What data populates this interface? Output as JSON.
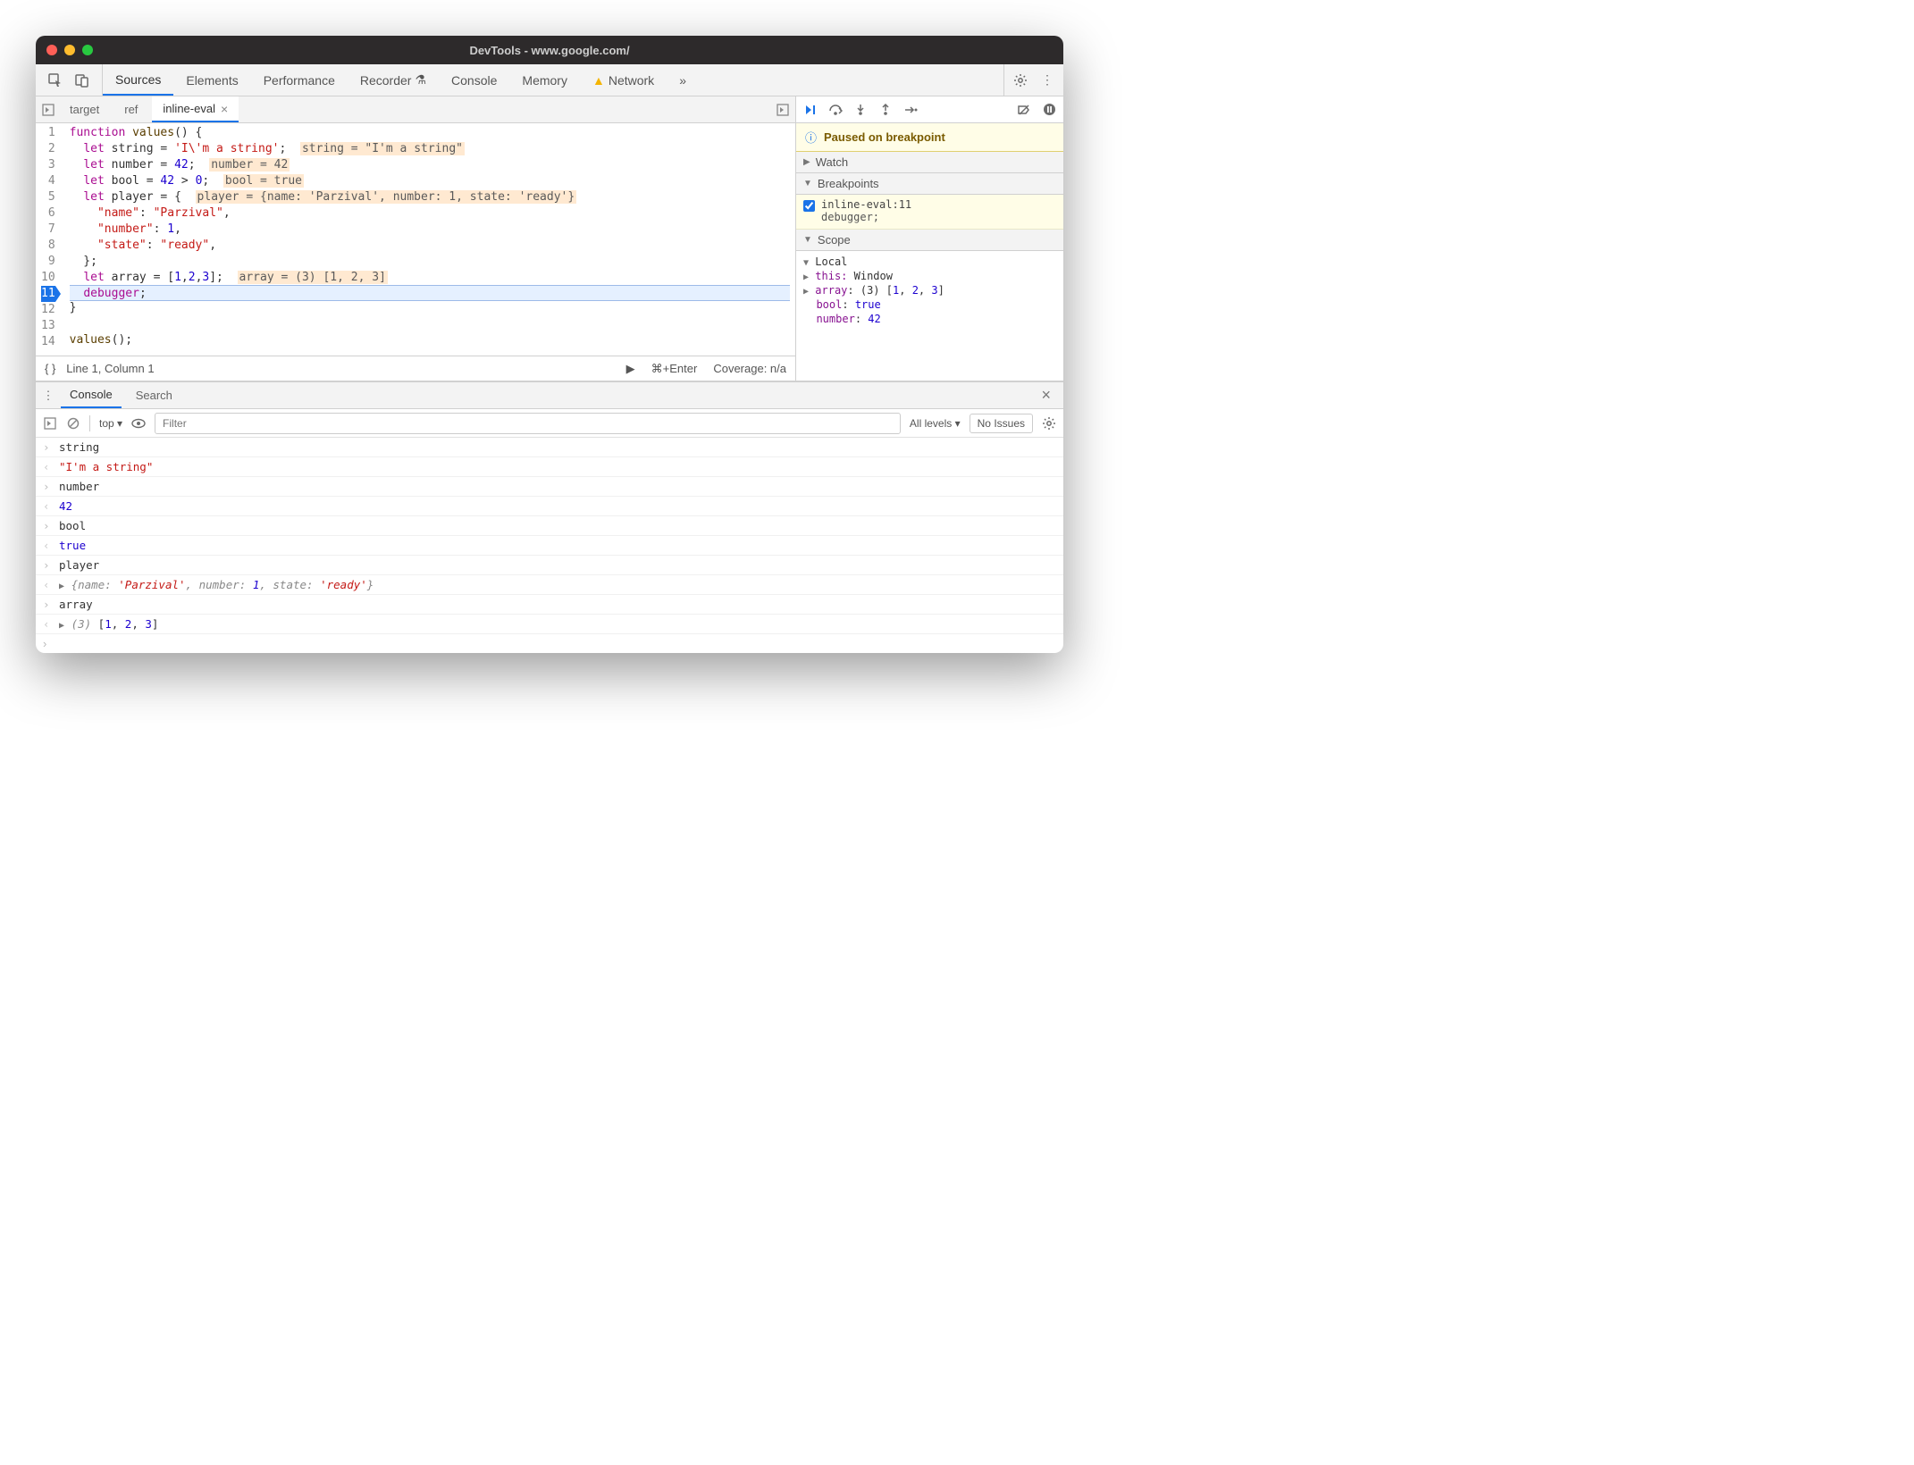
{
  "window": {
    "title": "DevTools - www.google.com/"
  },
  "toolbar": {
    "tabs": [
      "Sources",
      "Elements",
      "Performance",
      "Recorder",
      "Console",
      "Memory",
      "Network"
    ],
    "active": "Sources",
    "has_warning": true
  },
  "file_tabs": {
    "items": [
      {
        "label": "target",
        "active": false
      },
      {
        "label": "ref",
        "active": false
      },
      {
        "label": "inline-eval",
        "active": true,
        "closable": true
      }
    ]
  },
  "editor": {
    "lines": [
      {
        "n": 1,
        "html": "<span class='kw'>function</span> <span class='func'>values</span>() {"
      },
      {
        "n": 2,
        "html": "  <span class='kw'>let</span> string = <span class='str'>'I\\'m a string'</span>;  <span class='inline-hint'>string = \"I'm a string\"</span>"
      },
      {
        "n": 3,
        "html": "  <span class='kw'>let</span> number = <span class='num'>42</span>;  <span class='inline-hint'>number = 42</span>"
      },
      {
        "n": 4,
        "html": "  <span class='kw'>let</span> bool = <span class='num'>42</span> &gt; <span class='num'>0</span>;  <span class='inline-hint'>bool = true</span>"
      },
      {
        "n": 5,
        "html": "  <span class='kw'>let</span> player = {  <span class='inline-hint'>player = {name: 'Parzival', number: 1, state: 'ready'}</span>"
      },
      {
        "n": 6,
        "html": "    <span class='str'>\"name\"</span>: <span class='str'>\"Parzival\"</span>,"
      },
      {
        "n": 7,
        "html": "    <span class='str'>\"number\"</span>: <span class='num'>1</span>,"
      },
      {
        "n": 8,
        "html": "    <span class='str'>\"state\"</span>: <span class='str'>\"ready\"</span>,"
      },
      {
        "n": 9,
        "html": "  };"
      },
      {
        "n": 10,
        "html": "  <span class='kw'>let</span> array = [<span class='num'>1</span>,<span class='num'>2</span>,<span class='num'>3</span>];  <span class='inline-hint'>array = (3) [1, 2, 3]</span>"
      },
      {
        "n": 11,
        "hl": true,
        "html": "  <span class='kw'>debugger</span>;"
      },
      {
        "n": 12,
        "html": "}"
      },
      {
        "n": 13,
        "html": ""
      },
      {
        "n": 14,
        "html": "<span class='func'>values</span>();"
      }
    ]
  },
  "statusbar": {
    "left": "Line 1, Column 1",
    "cmd": "⌘+Enter",
    "coverage": "Coverage: n/a"
  },
  "debugger": {
    "paused_msg": "Paused on breakpoint",
    "sections": {
      "watch": "Watch",
      "breakpoints": "Breakpoints",
      "scope": "Scope"
    },
    "breakpoint": {
      "checked": true,
      "title": "inline-eval:11",
      "code": "debugger;"
    },
    "scope": {
      "local": "Local",
      "this_label": "this:",
      "this_val": "Window",
      "rows": [
        {
          "k": "array",
          "v": "(3) [1, 2, 3]",
          "type": "arr",
          "expand": true
        },
        {
          "k": "bool",
          "v": "true",
          "type": "bool"
        },
        {
          "k": "number",
          "v": "42",
          "type": "num"
        }
      ]
    }
  },
  "drawer": {
    "tabs": [
      "Console",
      "Search"
    ],
    "active": "Console",
    "filter_placeholder": "Filter",
    "levels": "All levels",
    "issues": "No Issues",
    "context": "top"
  },
  "console": [
    {
      "dir": "in",
      "text": "string"
    },
    {
      "dir": "out",
      "html": "<span class='cstr'>\"I'm a string\"</span>"
    },
    {
      "dir": "in",
      "text": "number"
    },
    {
      "dir": "out",
      "html": "<span class='cnum'>42</span>"
    },
    {
      "dir": "in",
      "text": "bool"
    },
    {
      "dir": "out",
      "html": "<span class='cbool'>true</span>"
    },
    {
      "dir": "in",
      "text": "player"
    },
    {
      "dir": "out",
      "html": "<span class='tri'>▶</span> <span class='cobj'>{<span class='k'>name</span>: <span class='s'>'Parzival'</span>, <span class='k'>number</span>: <span class='n'>1</span>, <span class='k'>state</span>: <span class='s'>'ready'</span>}</span>"
    },
    {
      "dir": "in",
      "text": "array"
    },
    {
      "dir": "out",
      "html": "<span class='tri'>▶</span> <span class='cobj'>(3)</span> <span class='arr'>[<span class='cnum'>1</span>, <span class='cnum'>2</span>, <span class='cnum'>3</span>]</span>"
    }
  ]
}
